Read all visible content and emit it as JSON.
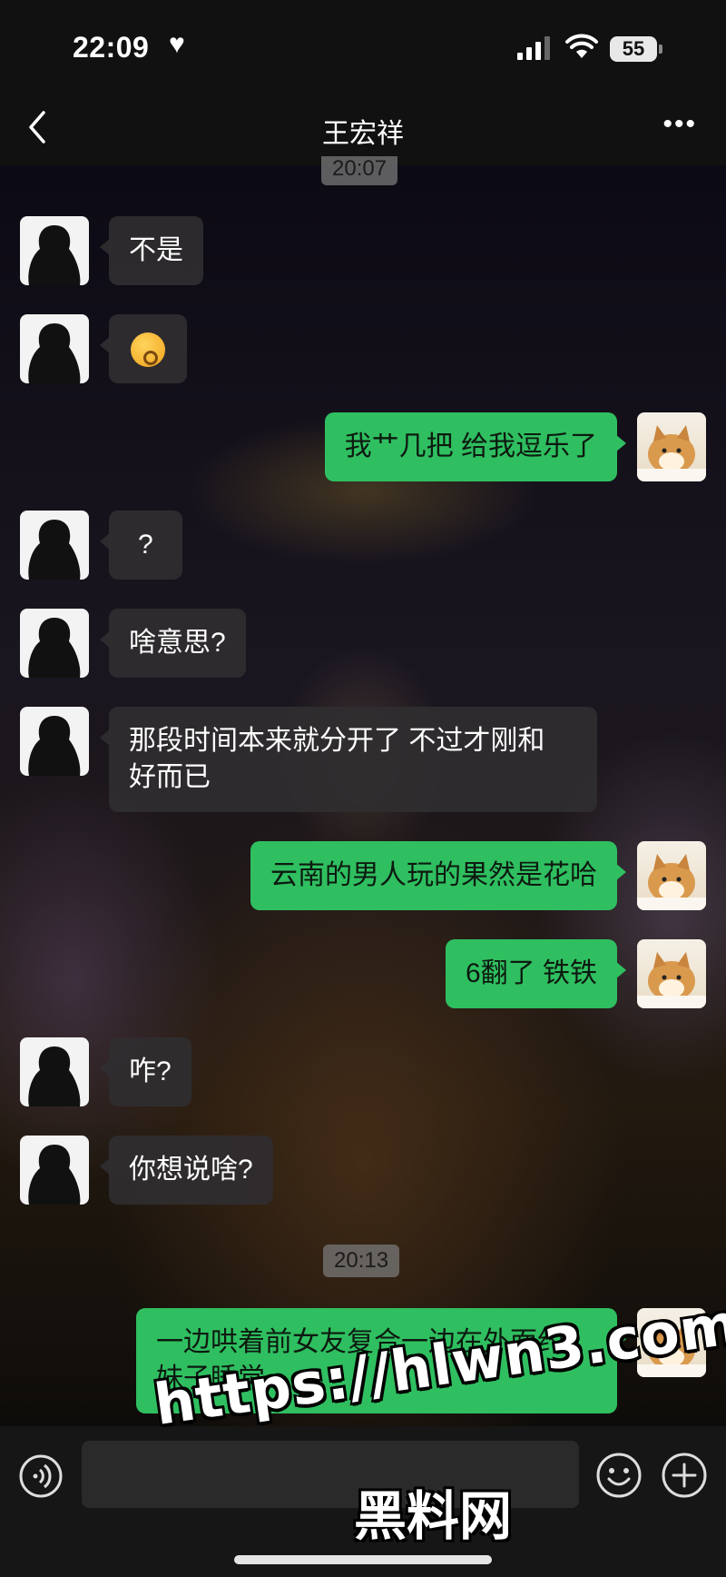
{
  "status_bar": {
    "time": "22:09",
    "heart_icon": "heart-icon",
    "battery": "55"
  },
  "header": {
    "title": "王宏祥",
    "back_icon": "chevron-left-icon",
    "more_icon": "more-dots-icon"
  },
  "timestamps": [
    "20:07",
    "20:13"
  ],
  "messages": [
    {
      "side": "left",
      "text": "不是"
    },
    {
      "side": "left",
      "text": "",
      "emoji": "sleepy-face-emoji"
    },
    {
      "side": "right",
      "text": "我艹几把 给我逗乐了"
    },
    {
      "side": "left",
      "text": "?"
    },
    {
      "side": "left",
      "text": "啥意思?"
    },
    {
      "side": "left",
      "text": "那段时间本来就分开了 不过才刚和\n好而已"
    },
    {
      "side": "right",
      "text": "云南的男人玩的果然是花哈"
    },
    {
      "side": "right",
      "text": "6翻了 铁铁"
    },
    {
      "side": "left",
      "text": "咋?"
    },
    {
      "side": "left",
      "text": "你想说啥?"
    },
    {
      "side": "right",
      "text": "一边哄着前女友复合一边在外面约\n妹子睡觉"
    }
  ],
  "input_bar": {
    "voice_icon": "voice-icon",
    "emoji_icon": "smile-icon",
    "plus_icon": "plus-icon",
    "input_value": ""
  },
  "watermark": {
    "url": "https://hlwn3.com",
    "site": "黑料网"
  },
  "colors": {
    "bubble_out": "#2fbf60",
    "bubble_in": "#302e30",
    "bar_bg": "#111111"
  }
}
